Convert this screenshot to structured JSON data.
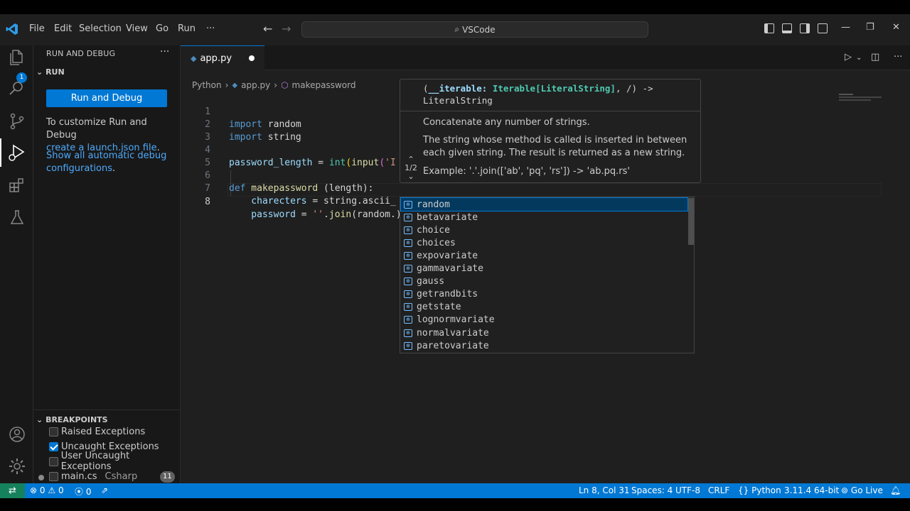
{
  "menu": [
    "File",
    "Edit",
    "Selection",
    "View",
    "Go",
    "Run",
    "···"
  ],
  "command_center": "VSCode",
  "window_controls": {
    "minimize": "—",
    "restore": "❐",
    "close": "✕"
  },
  "activity": {
    "explorer_badge": "1"
  },
  "sidebar": {
    "title": "RUN AND DEBUG",
    "more": "···",
    "run_header": "RUN",
    "run_debug_button": "Run and Debug",
    "customize_text": "To customize Run and Debug",
    "launch_link": "create a launch.json file",
    "launch_suffix": ".",
    "auto_debug_link": "Show all automatic debug configurations",
    "auto_debug_suffix": ".",
    "breakpoints": {
      "header": "BREAKPOINTS",
      "items": [
        {
          "label": "Raised Exceptions",
          "checked": false
        },
        {
          "label": "Uncaught Exceptions",
          "checked": true
        },
        {
          "label": "User Uncaught Exceptions",
          "checked": false
        }
      ],
      "file": "main.cs",
      "file_lang": "Csharp",
      "file_count": "11"
    }
  },
  "tab": {
    "label": "app.py"
  },
  "breadcrumb": [
    "Python",
    "app.py",
    "makepassword"
  ],
  "code": {
    "l1": {
      "num": "1",
      "kw": "import",
      "rest": " random"
    },
    "l2": {
      "num": "2",
      "kw": "import",
      "rest": " string"
    },
    "l3": {
      "num": "3"
    },
    "l4": {
      "num": "4",
      "a": "password_length",
      "b": " = ",
      "c": "int",
      "d": "(",
      "e": "input",
      "f": "(",
      "g": "'I"
    },
    "l5": {
      "num": "5"
    },
    "l6": {
      "num": "6",
      "kw": "def",
      "fn": " makepassword",
      "rest": " (length):"
    },
    "l7": {
      "num": "7",
      "a": "    charecters",
      "b": " = string.ascii_"
    },
    "l8": {
      "num": "8",
      "a": "    password",
      "b": " = ",
      "c": "''",
      "d": ".",
      "e": "join",
      "f": "(random.)"
    }
  },
  "hover": {
    "sig_open": "(",
    "sig_param": "__iterable",
    "sig_colon": ": ",
    "sig_type": "Iterable[LiteralString]",
    "sig_rest": ", /) ->",
    "sig_return": "LiteralString",
    "p1": "Concatenate any number of strings.",
    "p2": "The string whose method is called is inserted in between each given string. The result is returned as a new string.",
    "p3": "Example: '.'.join(['ab', 'pq', 'rs']) -> 'ab.pq.rs'",
    "nav": "1/2"
  },
  "suggestions": [
    "random",
    "betavariate",
    "choice",
    "choices",
    "expovariate",
    "gammavariate",
    "gauss",
    "getrandbits",
    "getstate",
    "lognormvariate",
    "normalvariate",
    "paretovariate"
  ],
  "status": {
    "errors": "0",
    "warnings": "0",
    "ports": "0",
    "position": "Ln 8, Col 31",
    "spaces": "Spaces: 4",
    "encoding": "UTF-8",
    "eol": "CRLF",
    "language": "Python",
    "interpreter": "3.11.4 64-bit",
    "golive": "Go Live"
  },
  "colors": {
    "accent": "#0078d4",
    "remote": "#16825d",
    "keyword": "#569cd6"
  }
}
